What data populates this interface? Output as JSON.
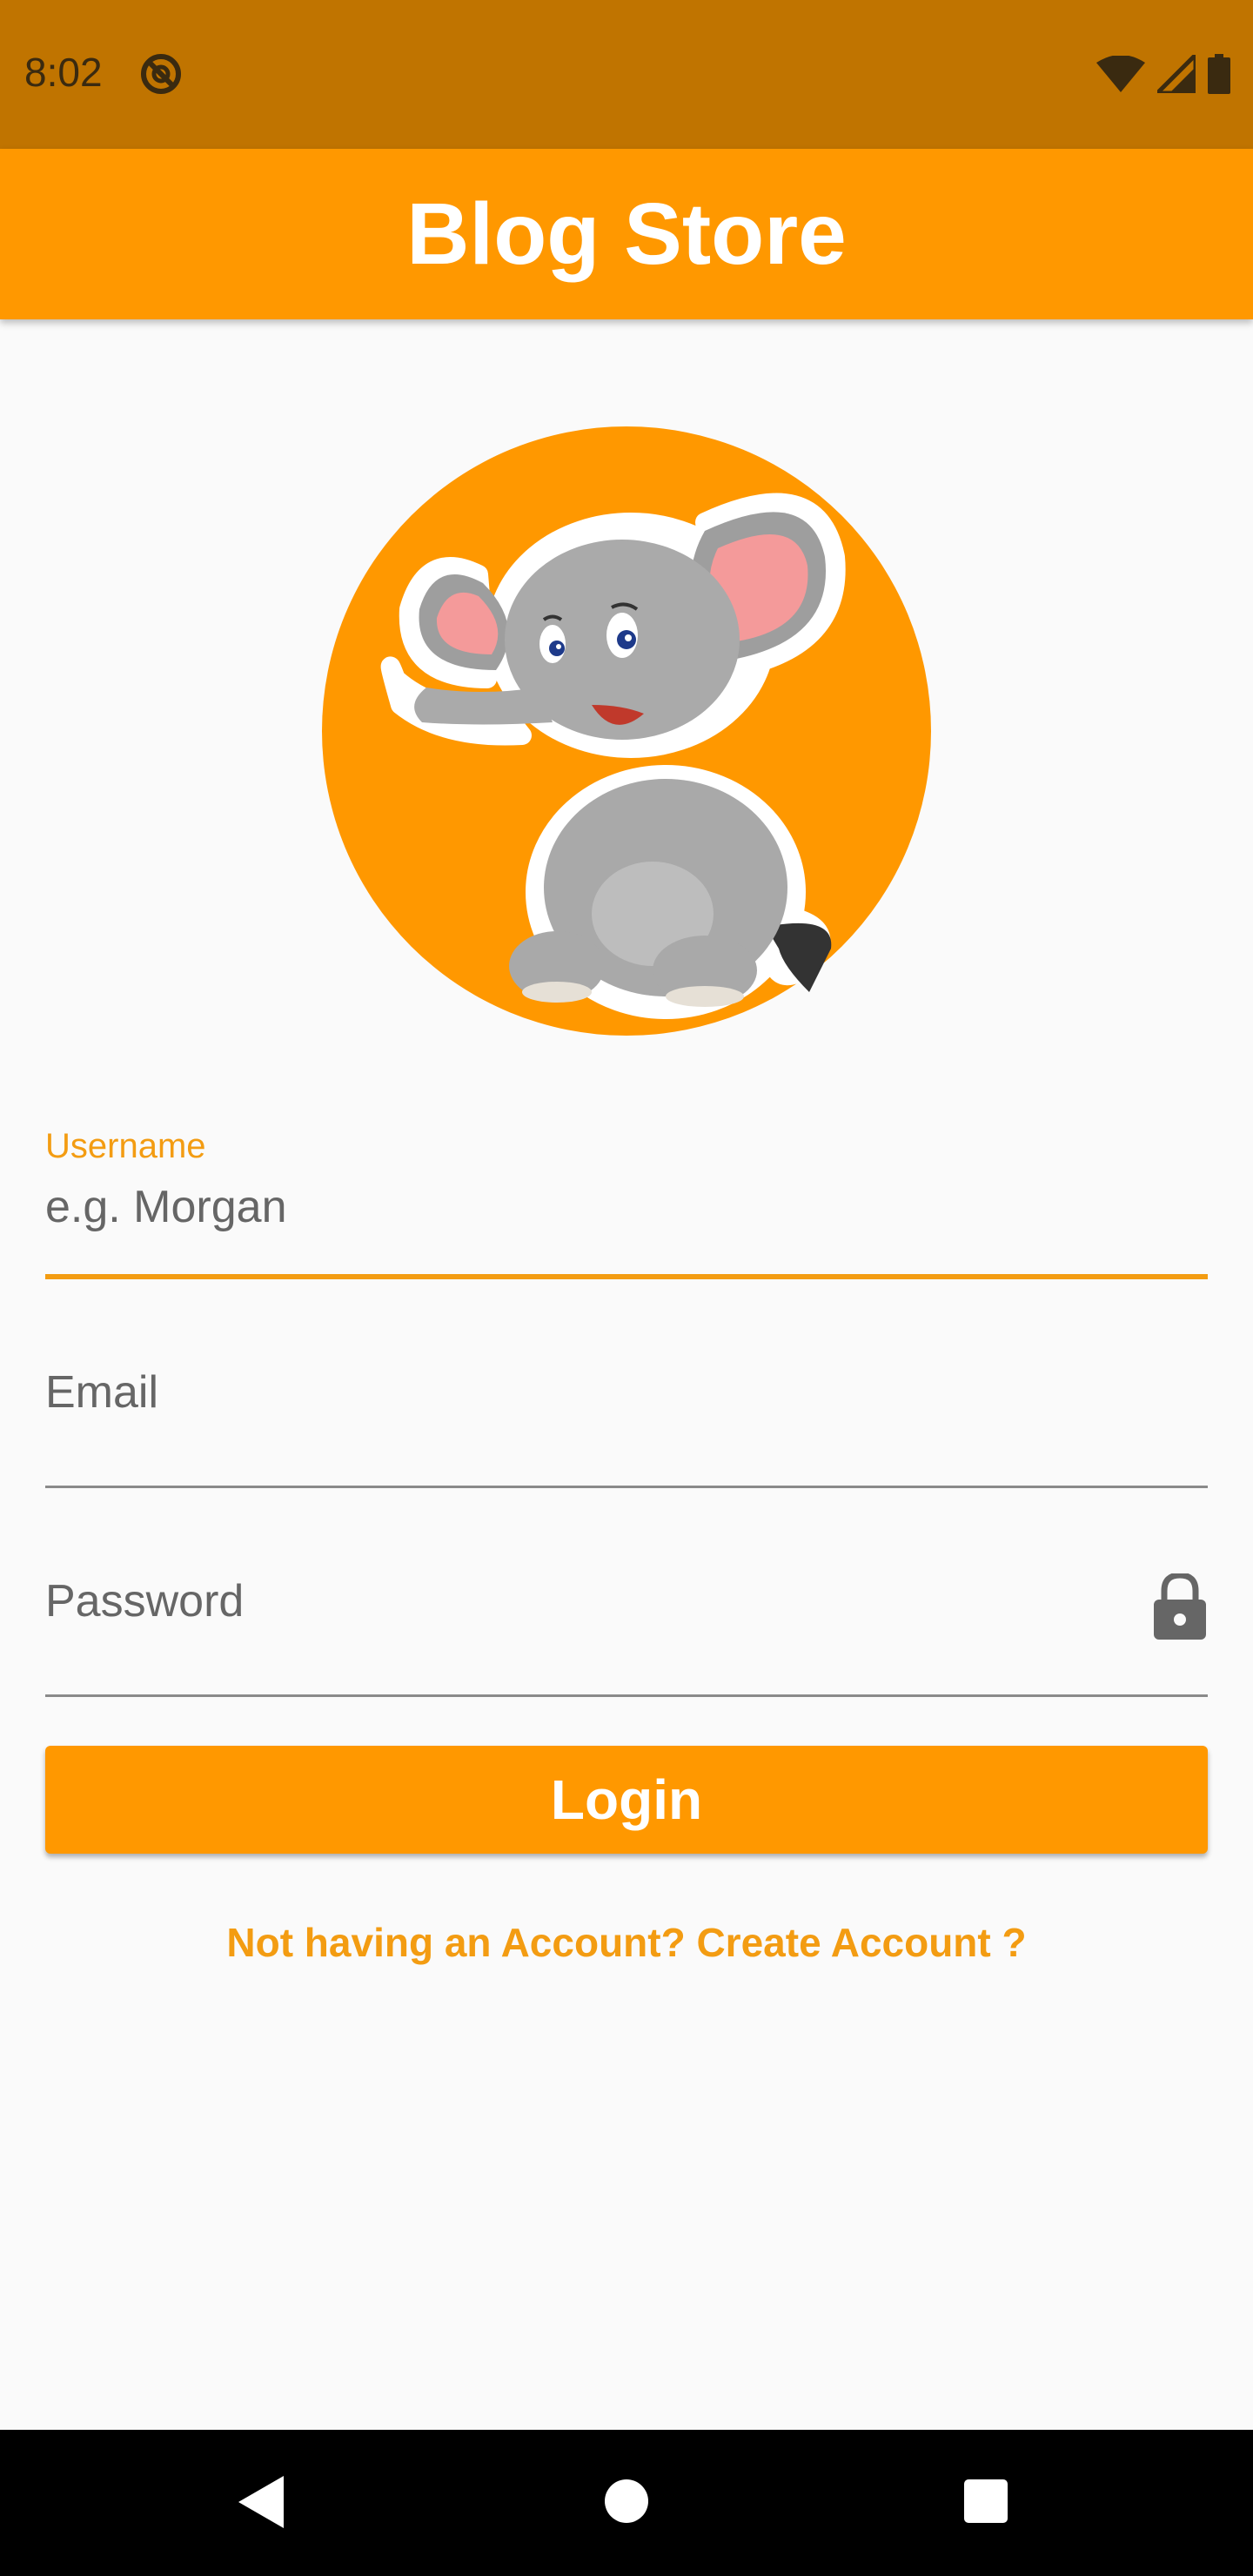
{
  "status_bar": {
    "time": "8:02",
    "icons": [
      "do-not-disturb-icon",
      "wifi-icon",
      "cell-signal-icon",
      "battery-icon"
    ]
  },
  "app_bar": {
    "title": "Blog Store"
  },
  "logo": {
    "icon": "elephant-logo",
    "background_color": "#ff9800"
  },
  "form": {
    "username": {
      "label": "Username",
      "value": "e.g.   Morgan",
      "focused": true
    },
    "email": {
      "placeholder": "Email"
    },
    "password": {
      "placeholder": "Password",
      "icon": "lock-icon"
    },
    "login_button": "Login",
    "create_account_link": "Not having an Account? Create Account ?"
  },
  "colors": {
    "primary": "#ff9800",
    "status_bar": "#c07400",
    "accent_text": "#f39c12"
  },
  "nav_bar": {
    "icons": [
      "back-icon",
      "home-icon",
      "recents-icon"
    ]
  }
}
